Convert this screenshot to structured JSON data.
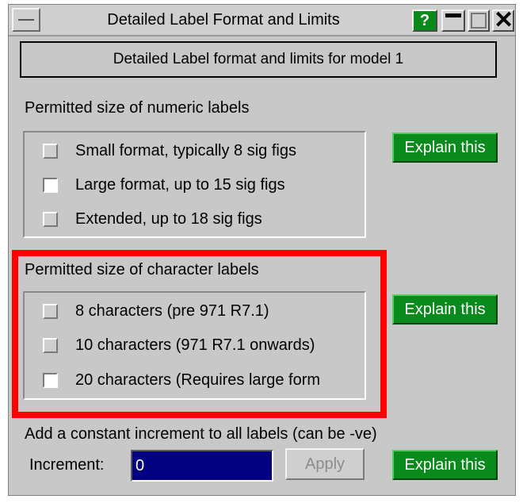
{
  "window": {
    "title": "Detailed Label Format and Limits",
    "help_label": "?"
  },
  "header": {
    "model_label": "Detailed Label format and limits for model 1"
  },
  "numeric": {
    "title": "Permitted size of numeric labels",
    "options": [
      {
        "label": "Small format, typically 8 sig figs",
        "checked": false
      },
      {
        "label": "Large format, up to 15 sig figs",
        "checked": true
      },
      {
        "label": "Extended, up to 18 sig figs",
        "checked": false
      }
    ],
    "explain_label": "Explain this"
  },
  "character": {
    "title": "Permitted size of character labels",
    "options": [
      {
        "label": " 8 characters (pre 971 R7.1)",
        "checked": false
      },
      {
        "label": "10 characters (971 R7.1 onwards)",
        "checked": false
      },
      {
        "label": "20 characters (Requires large form",
        "checked": true
      }
    ],
    "explain_label": "Explain this"
  },
  "increment": {
    "title": "Add a constant increment to all labels (can be -ve)",
    "label": "Increment:",
    "value": "0",
    "apply_label": "Apply",
    "explain_label": "Explain this"
  },
  "colors": {
    "button_green": "#0a8a1c",
    "input_navy": "#000080",
    "highlight_red": "#ff0000",
    "panel_grey": "#c8c8c8"
  }
}
